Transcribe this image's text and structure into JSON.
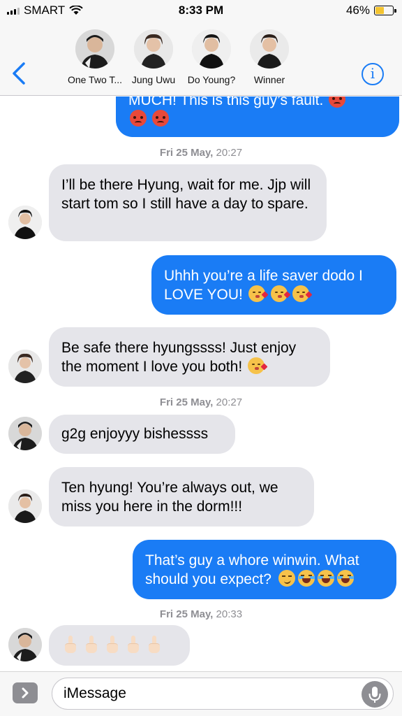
{
  "status_bar": {
    "carrier": "SMART",
    "time": "8:33 PM",
    "battery_percent": "46%",
    "battery_level": 0.46,
    "battery_color": "#f4c430"
  },
  "header": {
    "back_icon": "chevron-left-icon",
    "info_icon": "info-icon",
    "info_glyph": "i",
    "participants": [
      {
        "name": "One Two T..."
      },
      {
        "name": "Jung Uwu"
      },
      {
        "name": "Do Young?"
      },
      {
        "name": "Winner"
      }
    ]
  },
  "messages": {
    "m1": {
      "direction": "outgoing",
      "text": "MUCH! This is this guy’s fault. "
    },
    "ts1": {
      "date": "Fri 25 May,",
      "time": "20:27"
    },
    "m2": {
      "direction": "incoming",
      "text": "I’ll be there Hyung, wait for me. Jjp will start tom so I still have a day to spare."
    },
    "m3": {
      "direction": "outgoing",
      "text": "Uhhh you’re a life saver dodo I LOVE YOU! "
    },
    "m4": {
      "direction": "incoming",
      "text": "Be safe there hyungssss! Just enjoy the moment I love you both! "
    },
    "ts2": {
      "date": "Fri 25 May,",
      "time": "20:27"
    },
    "m5": {
      "direction": "incoming",
      "text": "g2g enjoyyy bishessss"
    },
    "m6": {
      "direction": "incoming",
      "text": "Ten hyung! You’re always out, we miss you here in the dorm!!!"
    },
    "m7": {
      "direction": "outgoing",
      "text": "That’s guy a whore winwin. What should you expect? "
    },
    "ts3": {
      "date": "Fri 25 May,",
      "time": "20:33"
    },
    "m8": {
      "direction": "incoming",
      "text": ""
    }
  },
  "input_bar": {
    "placeholder": "iMessage",
    "apps_icon": "app-store-icon",
    "mic_icon": "microphone-icon"
  },
  "colors": {
    "outgoing_bubble": "#1a7cf5",
    "incoming_bubble": "#e5e5ea",
    "accent": "#1a7cf5",
    "timestamp": "#8e8e93"
  }
}
